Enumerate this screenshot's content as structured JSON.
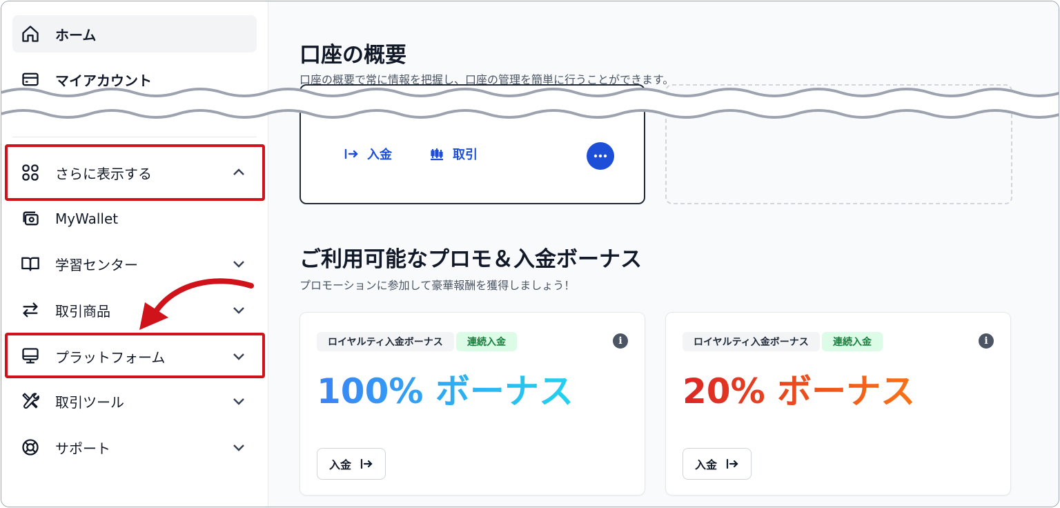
{
  "sidebar": {
    "items": [
      {
        "label": "ホーム"
      },
      {
        "label": "マイアカウント"
      },
      {
        "label": "さらに表示する"
      },
      {
        "label": "MyWallet"
      },
      {
        "label": "学習センター"
      },
      {
        "label": "取引商品"
      },
      {
        "label": "プラットフォーム"
      },
      {
        "label": "取引ツール"
      },
      {
        "label": "サポート"
      }
    ]
  },
  "overview": {
    "title": "口座の概要",
    "subtitle": "口座の概要で常に情報を把握し、口座の管理を簡単に行うことができます。",
    "deposit_label": "入金",
    "trade_label": "取引"
  },
  "promos": {
    "title": "ご利用可能なプロモ＆入金ボーナス",
    "subtitle": "プロモーションに参加して豪華報酬を獲得しましょう！",
    "cards": [
      {
        "tag": "ロイヤルティ入金ボーナス",
        "badge": "連続入金",
        "bonus": "100% ボーナス",
        "button": "入金",
        "accent": "#3b82f6"
      },
      {
        "tag": "ロイヤルティ入金ボーナス",
        "badge": "連続入金",
        "bonus": "20% ボーナス",
        "button": "入金",
        "accent": "#dc2626"
      }
    ]
  },
  "colors": {
    "highlight": "#d0121b",
    "primary": "#1d4ed8"
  }
}
